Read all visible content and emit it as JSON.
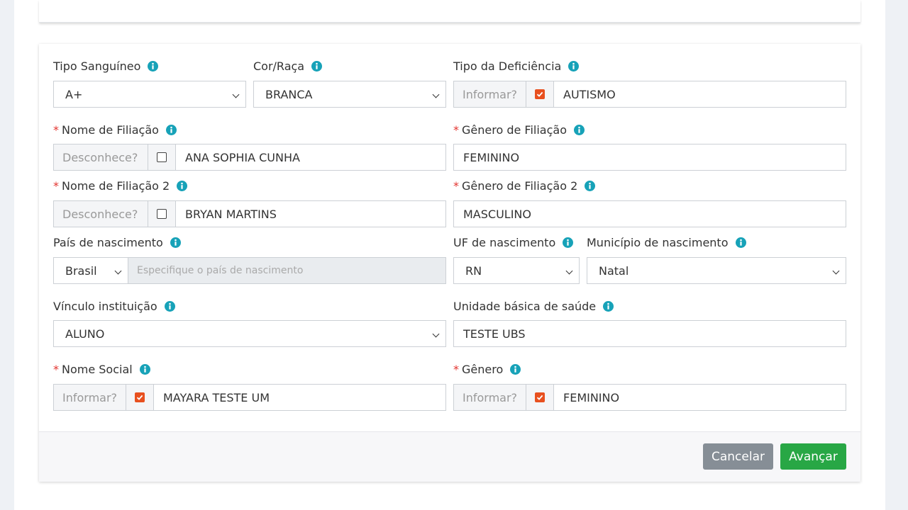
{
  "fields": {
    "tipo_sanguineo": {
      "label": "Tipo Sanguíneo",
      "value": "A+"
    },
    "cor_raca": {
      "label": "Cor/Raça",
      "value": "BRANCA"
    },
    "tipo_deficiencia": {
      "label": "Tipo da Deficiência",
      "addon": "Informar?",
      "checked": true,
      "value": "AUTISMO"
    },
    "nome_filiacao": {
      "label": "Nome de Filiação",
      "required": "*",
      "addon": "Desconhece?",
      "checked": false,
      "value": "ANA SOPHIA CUNHA"
    },
    "genero_filiacao": {
      "label": "Gênero de Filiação",
      "required": "*",
      "value": "FEMININO"
    },
    "nome_filiacao_2": {
      "label": "Nome de Filiação 2",
      "required": "*",
      "addon": "Desconhece?",
      "checked": false,
      "value": "BRYAN MARTINS"
    },
    "genero_filiacao_2": {
      "label": "Gênero de Filiação 2",
      "required": "*",
      "value": "MASCULINO"
    },
    "pais_nascimento": {
      "label": "País de nascimento",
      "value": "Brasil",
      "placeholder": "Especifique o país de nascimento"
    },
    "uf_nascimento": {
      "label": "UF de nascimento",
      "value": "RN"
    },
    "municipio_nascimento": {
      "label": "Município de nascimento",
      "value": "Natal"
    },
    "vinculo_instituicao": {
      "label": "Vínculo instituição",
      "value": "ALUNO"
    },
    "unidade_basica_saude": {
      "label": "Unidade básica de saúde",
      "value": "TESTE UBS"
    },
    "nome_social": {
      "label": "Nome Social",
      "required": "*",
      "addon": "Informar?",
      "checked": true,
      "value": "MAYARA TESTE UM"
    },
    "genero": {
      "label": "Gênero",
      "required": "*",
      "addon": "Informar?",
      "checked": true,
      "value": "FEMININO"
    }
  },
  "footer": {
    "cancel_label": "Cancelar",
    "next_label": "Avançar"
  },
  "colors": {
    "accent_check": "#e8501f",
    "info_icon": "#17a2b8",
    "cancel": "#868e96",
    "next": "#28a745",
    "required": "#e3342f"
  }
}
